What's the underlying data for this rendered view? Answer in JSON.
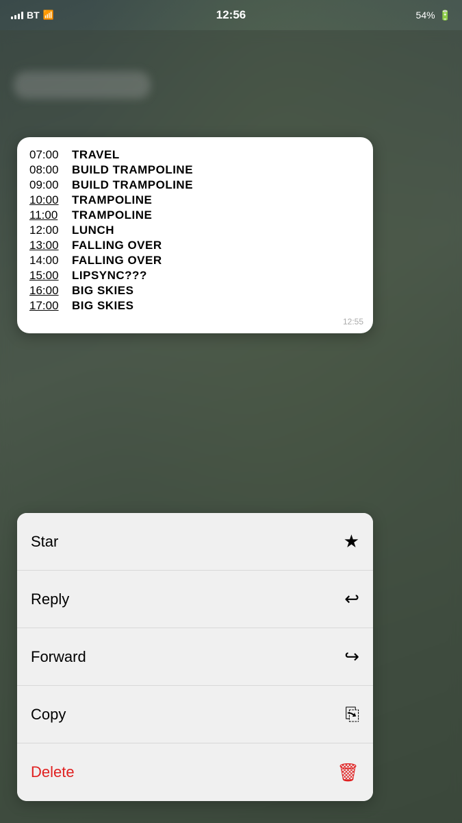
{
  "statusBar": {
    "carrier": "BT",
    "time": "12:56",
    "battery": "54%"
  },
  "messageCard": {
    "timestamp": "12:55",
    "schedule": [
      {
        "time": "07:00",
        "underline": false,
        "activity": "TRAVEL"
      },
      {
        "time": "08:00",
        "underline": false,
        "activity": "BUILD TRAMPOLINE"
      },
      {
        "time": "09:00",
        "underline": false,
        "activity": "BUILD TRAMPOLINE"
      },
      {
        "time": "10:00",
        "underline": true,
        "activity": "TRAMPOLINE"
      },
      {
        "time": "11:00",
        "underline": true,
        "activity": "TRAMPOLINE"
      },
      {
        "time": "12:00",
        "underline": false,
        "activity": "LUNCH"
      },
      {
        "time": "13:00",
        "underline": true,
        "activity": "FALLING OVER"
      },
      {
        "time": "14:00",
        "underline": false,
        "activity": "FALLING OVER"
      },
      {
        "time": "15:00",
        "underline": true,
        "activity": "LIPSYNC???"
      },
      {
        "time": "16:00",
        "underline": true,
        "activity": "BIG SKIES"
      },
      {
        "time": "17:00",
        "underline": true,
        "activity": "BIG SKIES"
      }
    ]
  },
  "contextMenu": {
    "items": [
      {
        "id": "star",
        "label": "Star",
        "icon": "★",
        "delete": false
      },
      {
        "id": "reply",
        "label": "Reply",
        "icon": "↩",
        "delete": false
      },
      {
        "id": "forward",
        "label": "Forward",
        "icon": "↪",
        "delete": false
      },
      {
        "id": "copy",
        "label": "Copy",
        "icon": "⧉",
        "delete": false
      },
      {
        "id": "delete",
        "label": "Delete",
        "icon": "🗑",
        "delete": true
      }
    ]
  }
}
